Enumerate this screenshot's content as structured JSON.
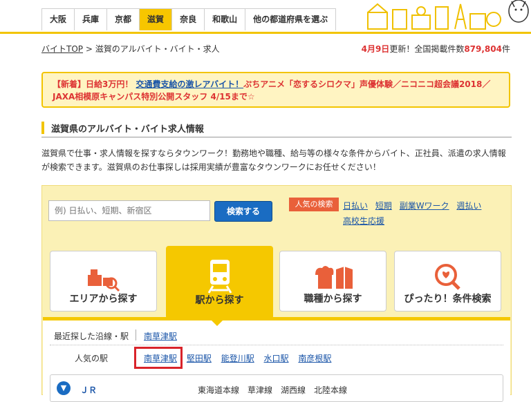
{
  "header": {
    "pref_tabs": [
      "大阪",
      "兵庫",
      "京都",
      "滋賀",
      "奈良",
      "和歌山",
      "他の都道府県を選ぶ"
    ],
    "active_pref": "滋賀",
    "accent_color": "#f2c400"
  },
  "breadcrumb": {
    "home": "バイトTOP",
    "separator": ">",
    "current": "滋賀のアルバイト・バイト・求人"
  },
  "update": {
    "date": "4月9日",
    "text1": "更新！全国掲載件数",
    "count": "879,804",
    "unit": "件"
  },
  "notice": {
    "prefix": "【新着】日給3万円！",
    "link1": "交通費支給の激レアバイト！",
    "link2": "ぷちアニメ「恋するシロクマ」声優体験／ニコニコ超会議2018／",
    "link3": "JAXA相模原キャンパス特別公開スタッフ 4/15まで☆"
  },
  "section": {
    "title": "滋賀県のアルバイト・バイト求人情報",
    "intro": "滋賀県で仕事・求人情報を探すならタウンワーク！勤務地や職種、給与等の様々な条件からバイト、正社員、派遣の求人情報が検索できます。滋賀県のお仕事探しは採用実績が豊富なタウンワークにお任せください！"
  },
  "search": {
    "placeholder": "例) 日払い、短期、新宿区",
    "button": "検索する",
    "popular_badge": "人気の検索",
    "popular_links": [
      "日払い",
      "短期",
      "副業Wワーク",
      "週払い",
      "高校生応援"
    ]
  },
  "cards": [
    {
      "label": "エリアから探す",
      "icon": "area-icon"
    },
    {
      "label": "駅から探す",
      "icon": "train-icon"
    },
    {
      "label": "職種から探す",
      "icon": "occupation-icon"
    },
    {
      "label": "ぴったり！条件検索",
      "icon": "condition-icon"
    }
  ],
  "station_panel": {
    "recent_label": "最近探した沿線・駅",
    "recent_station": "南草津駅",
    "popular_label": "人気の駅",
    "popular_stations": [
      "南草津駅",
      "堅田駅",
      "能登川駅",
      "水口駅",
      "南彦根駅"
    ],
    "line_group": "ＪＲ",
    "lines": "東海道本線　草津線　湖西線　北陸本線"
  }
}
